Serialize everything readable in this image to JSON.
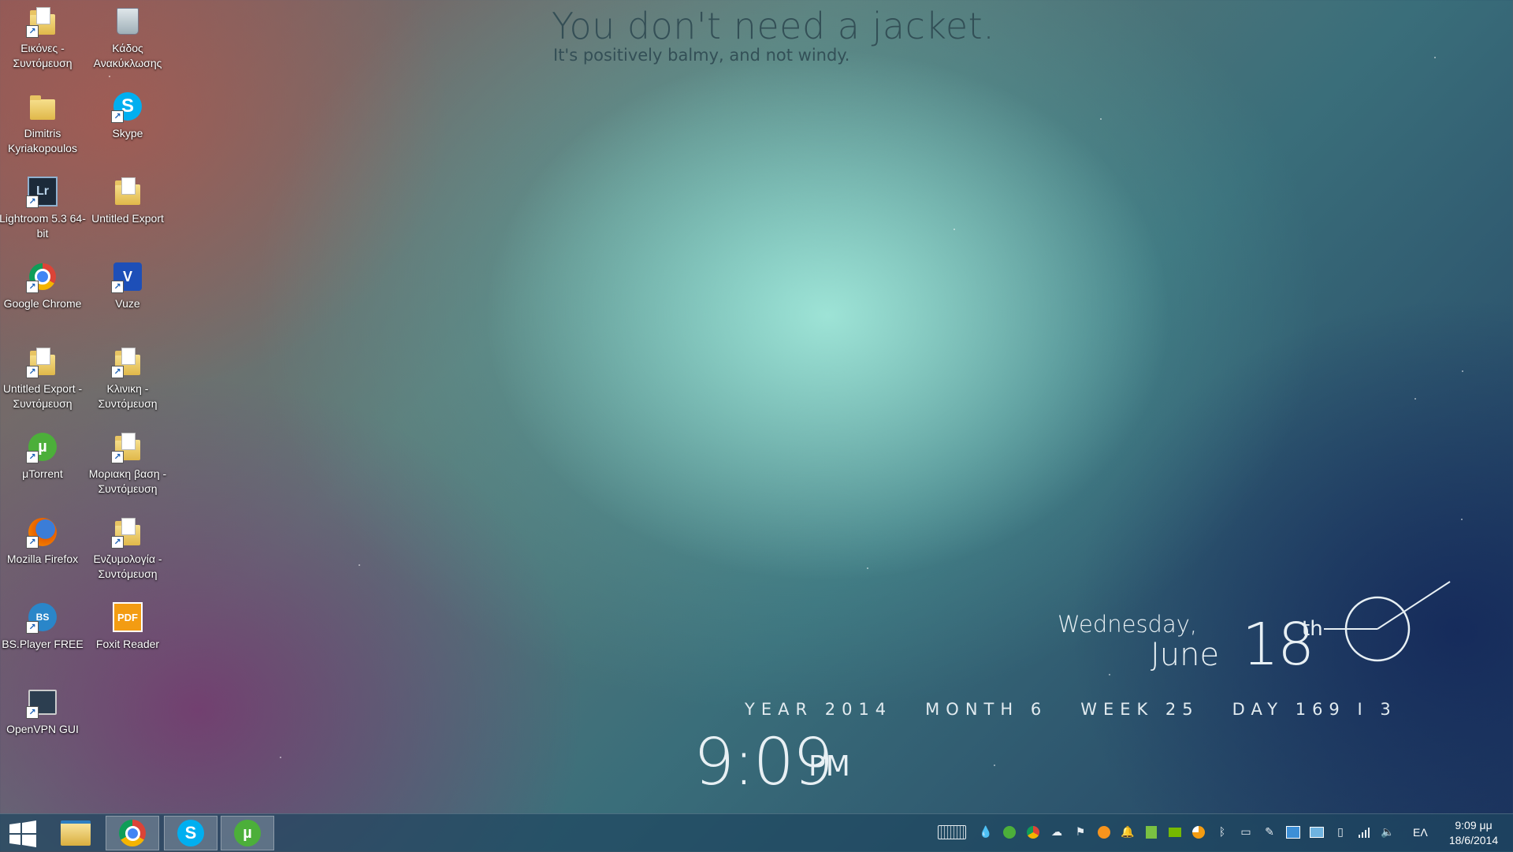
{
  "desktop": {
    "icons": [
      {
        "label": "Εικόνες - Συντόμευση"
      },
      {
        "label": "Κάδος Ανακύκλωσης"
      },
      {
        "label": "Dimitris Kyriakopoulos"
      },
      {
        "label": "Skype"
      },
      {
        "label": "Lightroom 5.3 64-bit"
      },
      {
        "label": "Untitled Export"
      },
      {
        "label": "Google Chrome"
      },
      {
        "label": "Vuze"
      },
      {
        "label": "Untitled Export - Συντόμευση"
      },
      {
        "label": "Κλινικη - Συντόμευση"
      },
      {
        "label": "μTorrent"
      },
      {
        "label": "Μοριακη βαση - Συντόμευση"
      },
      {
        "label": "Mozilla Firefox"
      },
      {
        "label": "Ενζυμολογία - Συντόμευση"
      },
      {
        "label": "BS.Player FREE"
      },
      {
        "label": "Foxit Reader"
      },
      {
        "label": "OpenVPN GUI"
      }
    ]
  },
  "weather": {
    "title": "You don't need a jacket.",
    "subtitle": "It's positively balmy, and not windy."
  },
  "date_widget": {
    "weekday": "Wednesday,",
    "month": "June",
    "day": "18",
    "suffix": "th"
  },
  "stats": {
    "year": "YEAR 2014",
    "month": "MONTH 6",
    "week": "WEEK 25",
    "day": "DAY 169 I 3"
  },
  "clock": {
    "time": "9:09",
    "ampm": "PM"
  },
  "taskbar": {
    "pinned": [
      "File Explorer",
      "Google Chrome",
      "Skype",
      "μTorrent"
    ],
    "language": "ΕΛ",
    "time": "9:09 μμ",
    "date": "18/6/2014"
  },
  "colors": {
    "taskbar": "#1e465f",
    "accent_text": "#e8f0f4",
    "weather_text": "#2f4a52"
  }
}
